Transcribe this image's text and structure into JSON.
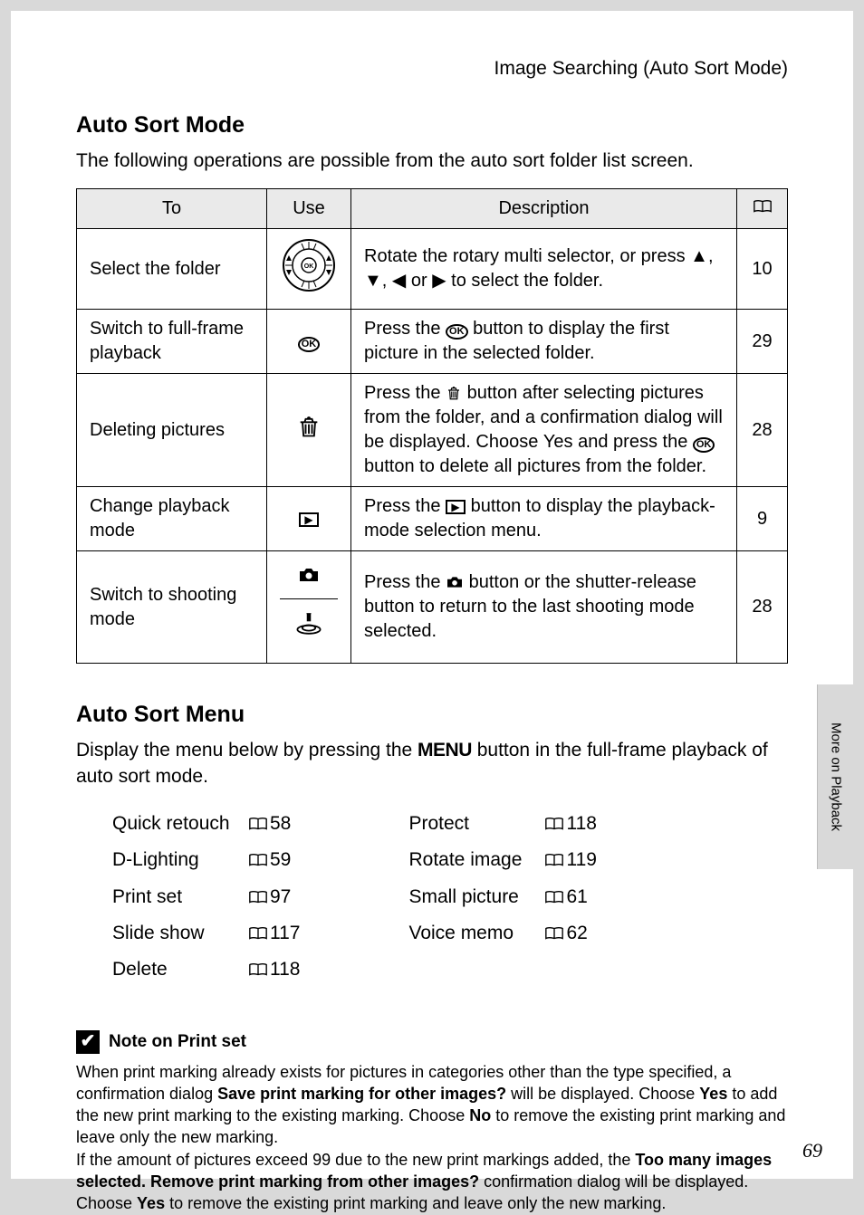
{
  "header": "Image Searching (Auto Sort Mode)",
  "section1_title": "Auto Sort Mode",
  "section1_intro": "The following operations are possible from the auto sort folder list screen.",
  "table": {
    "headers": {
      "to": "To",
      "use": "Use",
      "desc": "Description",
      "page_icon": "book"
    },
    "rows": [
      {
        "to": "Select the folder",
        "icon": "rotary-selector",
        "desc_parts": [
          "Rotate the rotary multi selector, or press ",
          "▲",
          ", ",
          "▼",
          ", ",
          "◀",
          " or ",
          "▶",
          " to select the folder."
        ],
        "page": "10"
      },
      {
        "to": "Switch to full-frame playback",
        "icon": "ok",
        "desc_parts": [
          "Press the ",
          "[OK]",
          " button to display the first picture in the selected folder."
        ],
        "page": "29"
      },
      {
        "to": "Deleting pictures",
        "icon": "trash",
        "desc_parts": [
          "Press the ",
          "[trash]",
          " button after selecting pictures from the folder, and a confirmation dialog will be displayed. Choose ",
          "Yes",
          " and press the ",
          "[OK]",
          " button to delete all pictures from the folder."
        ],
        "bold_indices": [
          3
        ],
        "page": "28"
      },
      {
        "to": "Change playback mode",
        "icon": "play",
        "desc_parts": [
          "Press the ",
          "[▶]",
          " button to display the playback-mode selection menu."
        ],
        "page": "9"
      },
      {
        "to": "Switch to shooting mode",
        "icon": "camera-shutter",
        "desc_parts": [
          "Press the ",
          "[camera]",
          " button or the shutter-release button to return to the last shooting mode selected."
        ],
        "page": "28"
      }
    ]
  },
  "section2_title": "Auto Sort Menu",
  "section2_intro_pre": "Display the menu below by pressing the ",
  "section2_intro_menu": "MENU",
  "section2_intro_post": " button in the full-frame playback of auto sort mode.",
  "menu": {
    "col1": [
      {
        "label": "Quick retouch",
        "page": "58"
      },
      {
        "label": "D-Lighting",
        "page": "59"
      },
      {
        "label": "Print set",
        "page": "97"
      },
      {
        "label": "Slide show",
        "page": "117"
      },
      {
        "label": "Delete",
        "page": "118"
      }
    ],
    "col2": [
      {
        "label": "Protect",
        "page": "118"
      },
      {
        "label": "Rotate image",
        "page": "119"
      },
      {
        "label": "Small picture",
        "page": "61"
      },
      {
        "label": "Voice memo",
        "page": "62"
      }
    ]
  },
  "note": {
    "title": "Note on Print set",
    "p1_pre": "When print marking already exists for pictures in categories other than the type specified, a confirmation dialog ",
    "p1_b1": "Save print marking for other images?",
    "p1_mid1": " will be displayed. Choose ",
    "p1_b2": "Yes",
    "p1_mid2": " to add the new print marking to the existing marking. Choose ",
    "p1_b3": "No",
    "p1_post": " to remove the existing print marking and leave only the new marking.",
    "p2_pre": "If the amount of pictures exceed 99 due to the new print markings added, the ",
    "p2_b1": "Too many images selected. Remove print marking from other images?",
    "p2_mid": " confirmation dialog will be displayed. Choose ",
    "p2_b2": "Yes",
    "p2_post": " to remove the existing print marking and leave only the new marking."
  },
  "side_tab": "More on Playback",
  "page_number": "69"
}
